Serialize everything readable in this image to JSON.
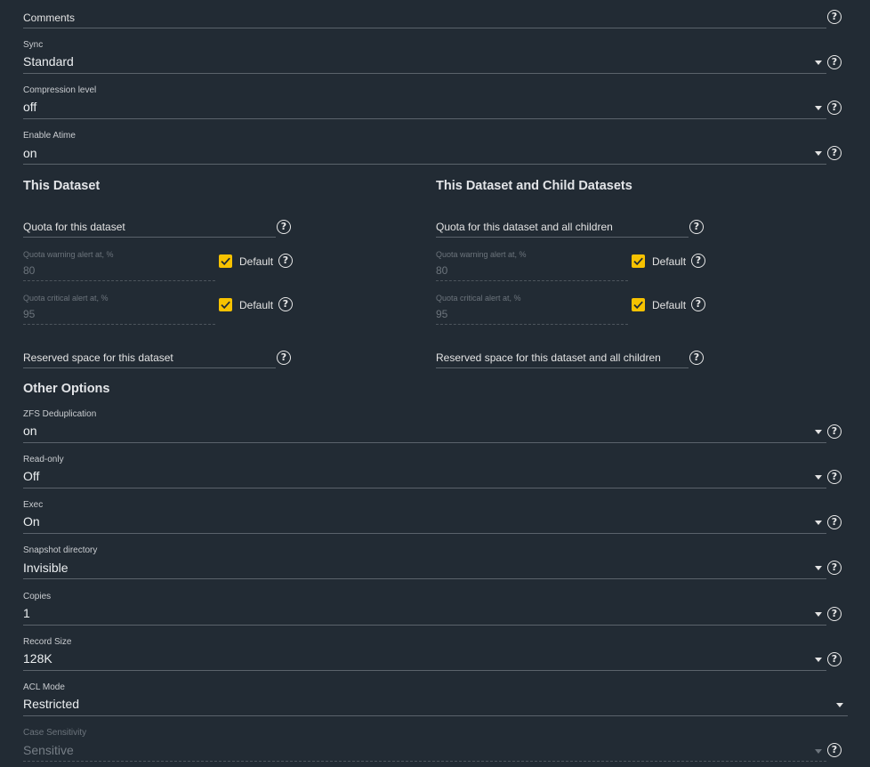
{
  "comments": {
    "label": "Comments"
  },
  "selects": [
    {
      "id": "sync",
      "label": "Sync",
      "value": "Standard"
    },
    {
      "id": "compression",
      "label": "Compression level",
      "value": "off"
    },
    {
      "id": "atime",
      "label": "Enable Atime",
      "value": "on"
    }
  ],
  "this_dataset": {
    "title": "This Dataset",
    "quota_label": "Quota for this dataset",
    "warning_label": "Quota warning alert at, %",
    "warning_value": "80",
    "critical_label": "Quota critical alert at, %",
    "critical_value": "95",
    "default_label": "Default",
    "reserved_label": "Reserved space for this dataset"
  },
  "child_datasets": {
    "title": "This Dataset and Child Datasets",
    "quota_label": "Quota for this dataset and all children",
    "warning_label": "Quota warning alert at, %",
    "warning_value": "80",
    "critical_label": "Quota critical alert at, %",
    "critical_value": "95",
    "default_label": "Default",
    "reserved_label": "Reserved space for this dataset and all children"
  },
  "other_options": {
    "title": "Other Options",
    "fields": [
      {
        "id": "dedup",
        "label": "ZFS Deduplication",
        "value": "on"
      },
      {
        "id": "readonly",
        "label": "Read-only",
        "value": "Off"
      },
      {
        "id": "exec",
        "label": "Exec",
        "value": "On"
      },
      {
        "id": "snapdir",
        "label": "Snapshot directory",
        "value": "Invisible"
      },
      {
        "id": "copies",
        "label": "Copies",
        "value": "1"
      },
      {
        "id": "recordsize",
        "label": "Record Size",
        "value": "128K"
      },
      {
        "id": "aclmode",
        "label": "ACL Mode",
        "value": "Restricted"
      },
      {
        "id": "casesensitivity",
        "label": "Case Sensitivity",
        "value": "Sensitive"
      }
    ]
  },
  "help_glyph": "?",
  "colors": {
    "accent": "#f7c200",
    "background": "#222b34",
    "divider": "#5b636b"
  }
}
